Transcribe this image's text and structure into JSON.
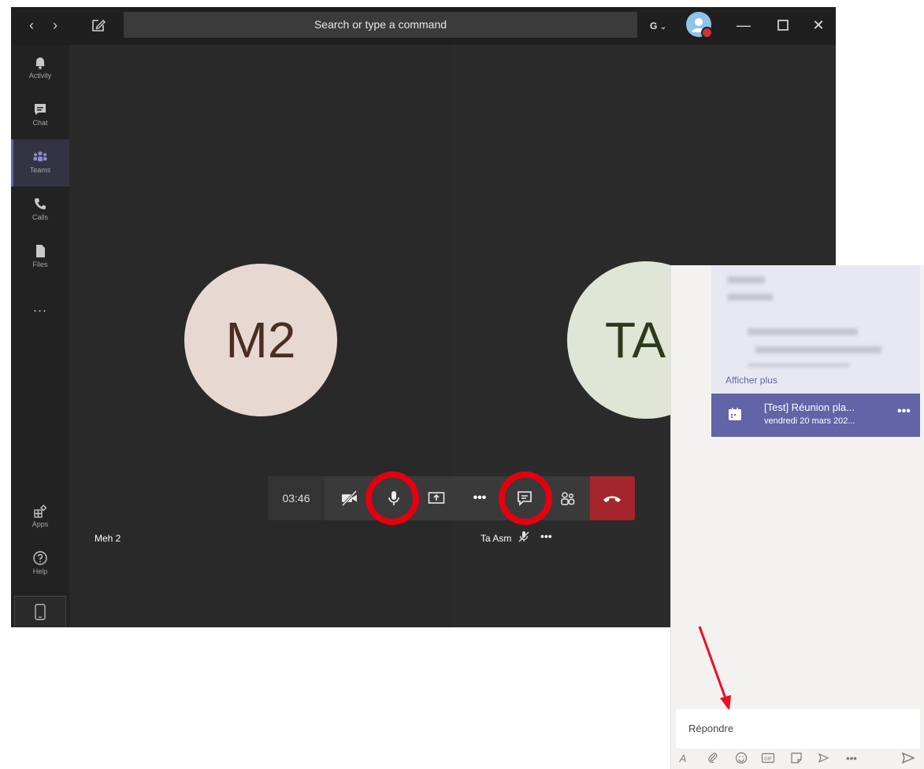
{
  "titlebar": {
    "search_placeholder": "Search or type a command",
    "account_initial": "G",
    "back_glyph": "‹",
    "forward_glyph": "›"
  },
  "sidebar": {
    "items": [
      {
        "label": "Activity",
        "icon": "bell-icon"
      },
      {
        "label": "Chat",
        "icon": "chat-icon"
      },
      {
        "label": "Teams",
        "icon": "teams-icon"
      },
      {
        "label": "Calls",
        "icon": "phone-icon"
      },
      {
        "label": "Files",
        "icon": "file-icon"
      }
    ],
    "more_label": "...",
    "apps_label": "Apps",
    "help_label": "Help"
  },
  "participants": [
    {
      "initials": "M2",
      "name": "Meh 2"
    },
    {
      "initials": "TA",
      "name": "Ta Asm"
    }
  ],
  "callbar": {
    "timer": "03:46",
    "more_label": "•••"
  },
  "participant_more": "•••",
  "chat": {
    "show_more": "Afficher plus",
    "meeting_title": "[Test] Réunion pla...",
    "meeting_date": "vendredi 20 mars 202...",
    "meeting_more": "•••",
    "reply_placeholder": "Répondre",
    "toolbar_more": "•••"
  },
  "colors": {
    "accent": "#6264a7",
    "hangup": "#a4262c",
    "highlight_ring": "#e40010",
    "arrow": "#e81123"
  }
}
